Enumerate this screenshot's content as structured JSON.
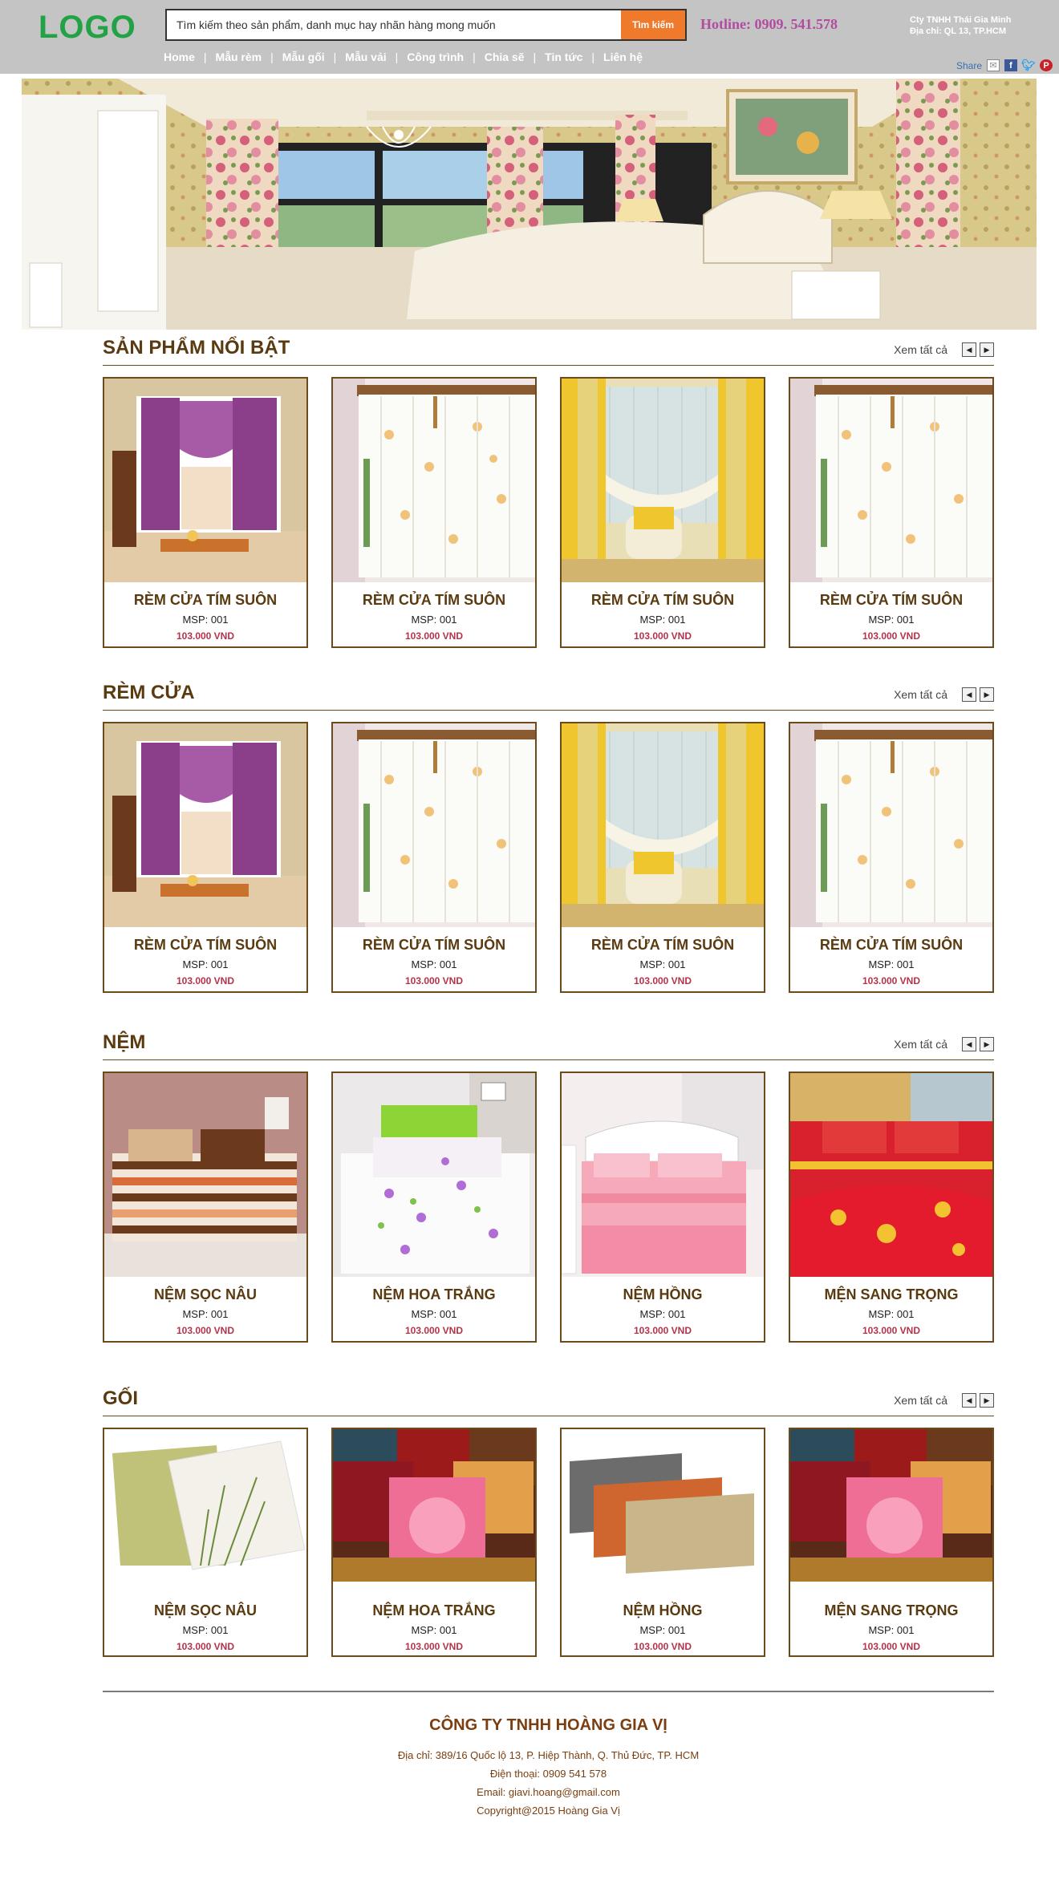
{
  "header": {
    "logo": "LOGO",
    "search_placeholder": "Tìm kiếm theo sản phẩm, danh mục hay nhãn hàng mong muốn",
    "search_button": "Tìm kiếm",
    "hotline": "Hotline: 0909. 541.578",
    "company_name": "Cty TNHH Thái Gia Minh",
    "company_address": "Địa chỉ: QL 13, TP.HCM",
    "nav": [
      "Home",
      "Mẫu rèm",
      "Mẫu gối",
      "Mẫu vải",
      "Công trình",
      "Chia sẽ",
      "Tin tức",
      "Liên hệ"
    ],
    "share_label": "Share"
  },
  "sections": [
    {
      "title": "SẢN PHẨM NỔI BẬT",
      "view_all": "Xem tất cả",
      "products": [
        {
          "name": "RÈM CỬA TÍM SUÔN",
          "code": "MSP: 001",
          "price": "103.000 VND"
        },
        {
          "name": "RÈM CỬA TÍM SUÔN",
          "code": "MSP: 001",
          "price": "103.000 VND"
        },
        {
          "name": "RÈM CỬA TÍM SUÔN",
          "code": "MSP: 001",
          "price": "103.000 VND"
        },
        {
          "name": "RÈM CỬA TÍM SUÔN",
          "code": "MSP: 001",
          "price": "103.000 VND"
        }
      ]
    },
    {
      "title": "RÈM CỬA",
      "view_all": "Xem tất cả",
      "products": [
        {
          "name": "RÈM CỬA TÍM SUÔN",
          "code": "MSP: 001",
          "price": "103.000 VND"
        },
        {
          "name": "RÈM CỬA TÍM SUÔN",
          "code": "MSP: 001",
          "price": "103.000 VND"
        },
        {
          "name": "RÈM CỬA TÍM SUÔN",
          "code": "MSP: 001",
          "price": "103.000 VND"
        },
        {
          "name": "RÈM CỬA TÍM SUÔN",
          "code": "MSP: 001",
          "price": "103.000 VND"
        }
      ]
    },
    {
      "title": "NỆM",
      "view_all": "Xem tất cả",
      "products": [
        {
          "name": "NỆM SỌC NÂU",
          "code": "MSP: 001",
          "price": "103.000 VND"
        },
        {
          "name": "NỆM HOA TRẮNG",
          "code": "MSP: 001",
          "price": "103.000 VND"
        },
        {
          "name": "NỆM HỒNG",
          "code": "MSP: 001",
          "price": "103.000 VND"
        },
        {
          "name": "MỆN SANG TRỌNG",
          "code": "MSP: 001",
          "price": "103.000 VND"
        }
      ]
    },
    {
      "title": "GỐI",
      "view_all": "Xem tất cả",
      "products": [
        {
          "name": "NỆM SỌC NÂU",
          "code": "MSP: 001",
          "price": "103.000 VND"
        },
        {
          "name": "NỆM HOA TRẮNG",
          "code": "MSP: 001",
          "price": "103.000 VND"
        },
        {
          "name": "NỆM HỒNG",
          "code": "MSP: 001",
          "price": "103.000 VND"
        },
        {
          "name": "MỆN SANG TRỌNG",
          "code": "MSP: 001",
          "price": "103.000 VND"
        }
      ]
    }
  ],
  "footer": {
    "company": "CÔNG TY TNHH HOÀNG GIA VỊ",
    "address": "Địa chỉ: 389/16 Quốc lộ 13, P. Hiệp Thành, Q. Thủ Đức, TP. HCM",
    "phone": "Điện thoại: 0909 541 578",
    "email": "Email: giavi.hoang@gmail.com",
    "copyright": "Copyright@2015 Hoàng Gia Vị"
  },
  "colors": {
    "header_bg": "#c4c4c4",
    "logo": "#21a345",
    "search_button": "#f07a2c",
    "hotline": "#b14ca0",
    "section_title": "#5a3a10",
    "card_border": "#6b4a1c",
    "price": "#b5334a",
    "footer_text": "#7a3e10"
  }
}
